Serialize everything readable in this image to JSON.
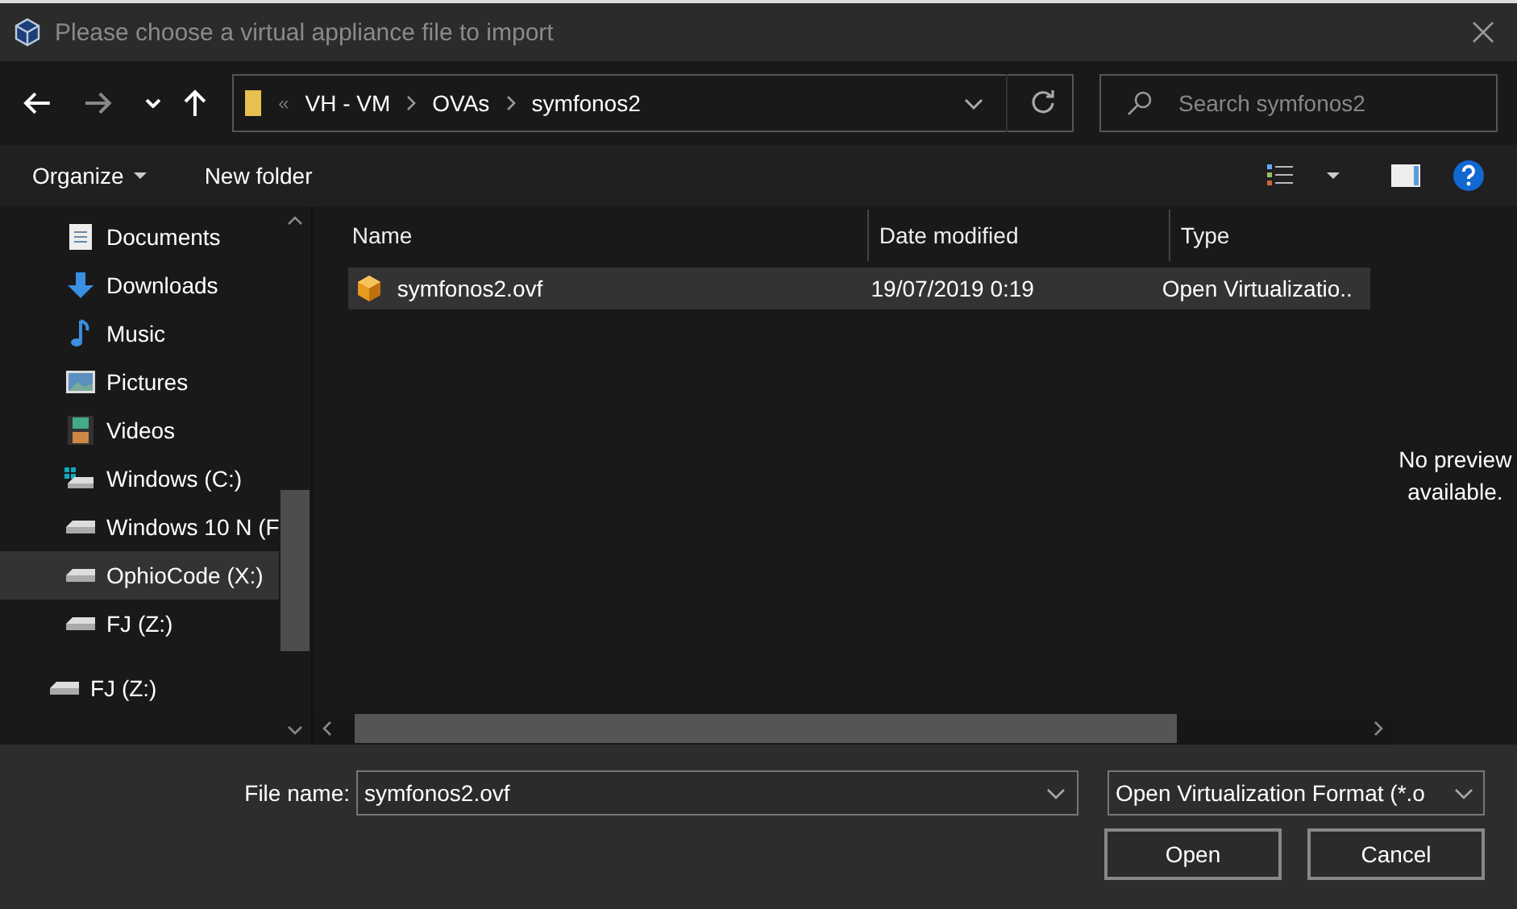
{
  "window": {
    "title": "Please choose a virtual appliance file to import"
  },
  "address_bar": {
    "breadcrumbs": [
      "VH - VM",
      "OVAs",
      "symfonos2"
    ],
    "overflow": "«"
  },
  "search": {
    "placeholder": "Search symfonos2"
  },
  "toolbar": {
    "organize": "Organize",
    "new_folder": "New folder"
  },
  "sidebar": {
    "nested_items": [
      {
        "label": "Documents",
        "kind": "documents",
        "selected": false
      },
      {
        "label": "Downloads",
        "kind": "downloads",
        "selected": false
      },
      {
        "label": "Music",
        "kind": "music",
        "selected": false
      },
      {
        "label": "Pictures",
        "kind": "pictures",
        "selected": false
      },
      {
        "label": "Videos",
        "kind": "videos",
        "selected": false
      },
      {
        "label": "Windows (C:)",
        "kind": "system-drive",
        "selected": false
      },
      {
        "label": "Windows 10 N (F",
        "kind": "drive",
        "selected": false
      },
      {
        "label": "OphioCode (X:)",
        "kind": "drive",
        "selected": true
      },
      {
        "label": "FJ (Z:)",
        "kind": "drive",
        "selected": false
      }
    ],
    "top_items": [
      {
        "label": "FJ (Z:)",
        "kind": "drive",
        "selected": false
      }
    ]
  },
  "table": {
    "columns": [
      "Name",
      "Date modified",
      "Type"
    ],
    "rows": [
      {
        "name": "symfonos2.ovf",
        "date_modified": "19/07/2019 0:19",
        "type": "Open Virtualizatio..",
        "selected": true
      }
    ]
  },
  "preview": {
    "message": "No preview available."
  },
  "footer": {
    "file_name_label": "File name:",
    "file_name": "symfonos2.ovf",
    "filter": "Open Virtualization Format (*.o",
    "buttons": [
      "Open",
      "Cancel"
    ]
  }
}
